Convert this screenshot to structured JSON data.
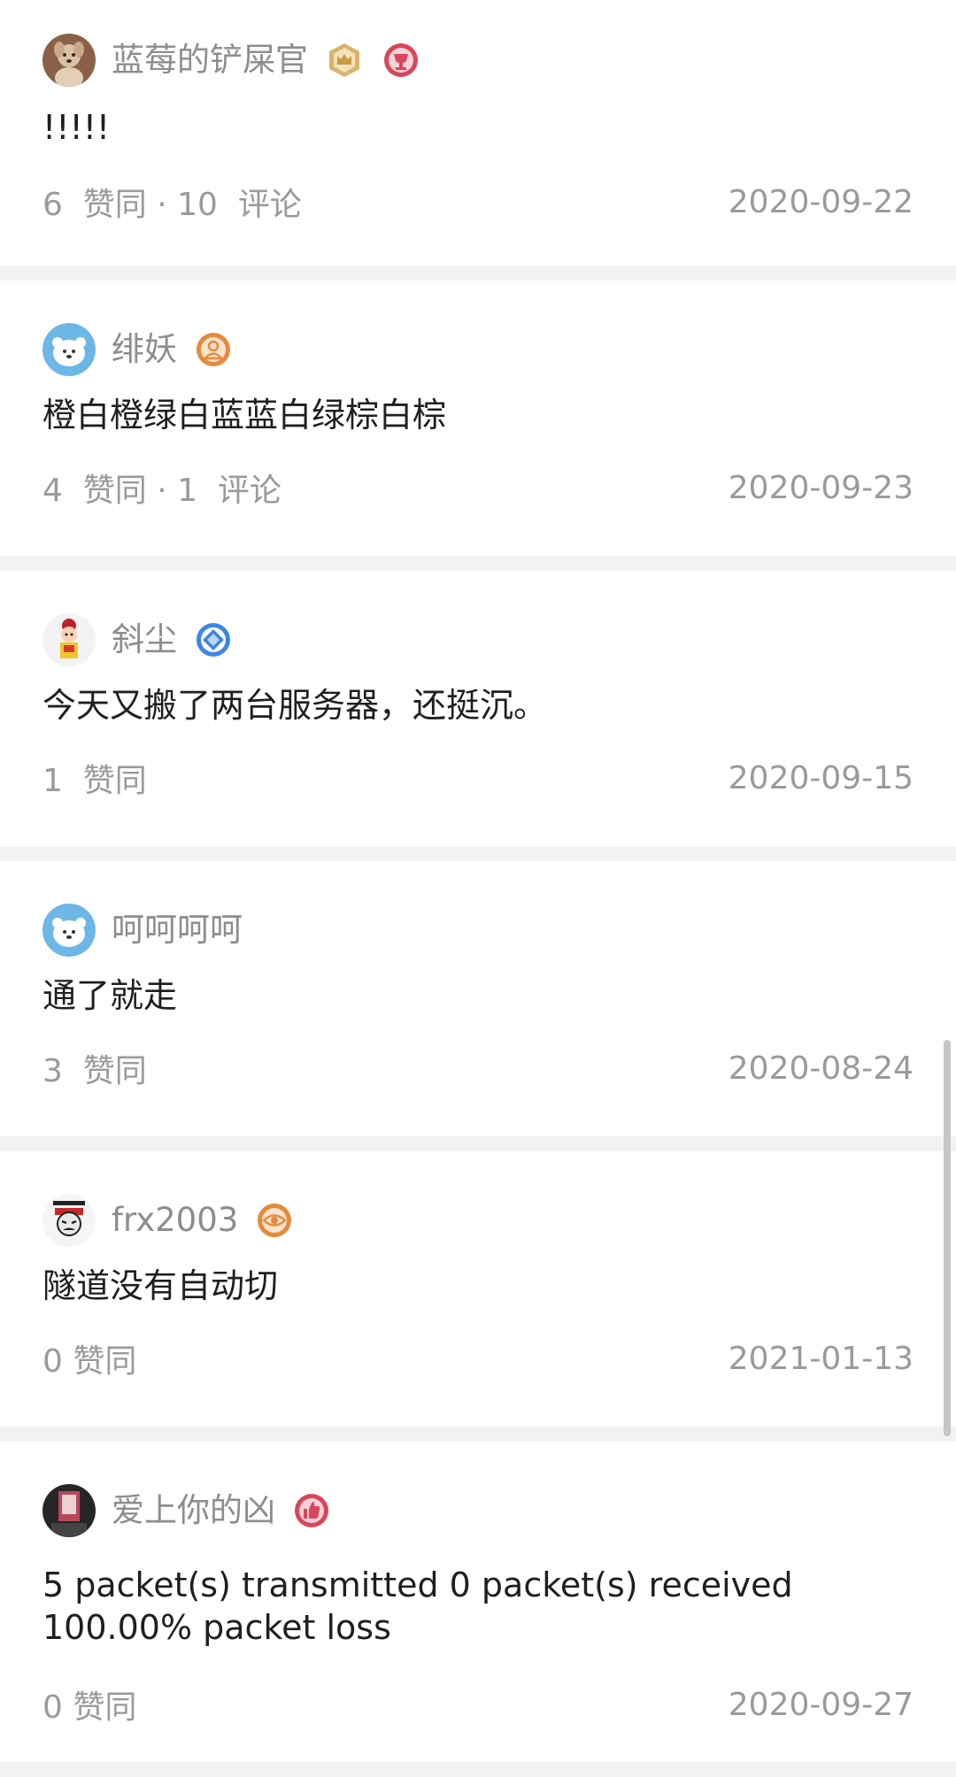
{
  "comments": [
    {
      "username": "蓝莓的铲屎官",
      "content": "!!!!!",
      "stats": "6  赞同 · 10  评论",
      "date": "2020-09-22",
      "avatar_icon": "dog-photo-avatar-icon",
      "badges": [
        "crown-badge-icon",
        "red-cup-badge-icon"
      ]
    },
    {
      "username": "绯妖",
      "content": "橙白橙绿白蓝蓝白绿棕白棕",
      "stats": "4  赞同 · 1  评论",
      "date": "2020-09-23",
      "avatar_icon": "default-polar-bear-avatar-icon",
      "badges": [
        "orange-person-badge-icon"
      ]
    },
    {
      "username": "斜尘",
      "content": "今天又搬了两台服务器，还挺沉。",
      "stats": "1  赞同",
      "date": "2020-09-15",
      "avatar_icon": "cartoon-child-avatar-icon",
      "badges": [
        "blue-diamond-badge-icon"
      ]
    },
    {
      "username": "呵呵呵呵",
      "content": "通了就走",
      "stats": "3  赞同",
      "date": "2020-08-24",
      "avatar_icon": "default-polar-bear-avatar-icon",
      "badges": []
    },
    {
      "username": "frx2003",
      "content": "隧道没有自动切",
      "stats": "0 赞同",
      "date": "2021-01-13",
      "avatar_icon": "meme-face-avatar-icon",
      "badges": [
        "orange-eye-badge-icon"
      ]
    },
    {
      "username": "爱上你的凶",
      "content": "5 packet(s) transmitted 0 packet(s) received 100.00% packet loss",
      "stats": "0 赞同",
      "date": "2020-09-27",
      "avatar_icon": "dark-photo-avatar-icon",
      "badges": [
        "red-thumbs-up-badge-icon"
      ]
    }
  ],
  "colors": {
    "background": "#f2f2f2",
    "card": "#ffffff",
    "username": "#8d8d8d",
    "content": "#1f1f1f",
    "meta": "#9a9a9a"
  }
}
